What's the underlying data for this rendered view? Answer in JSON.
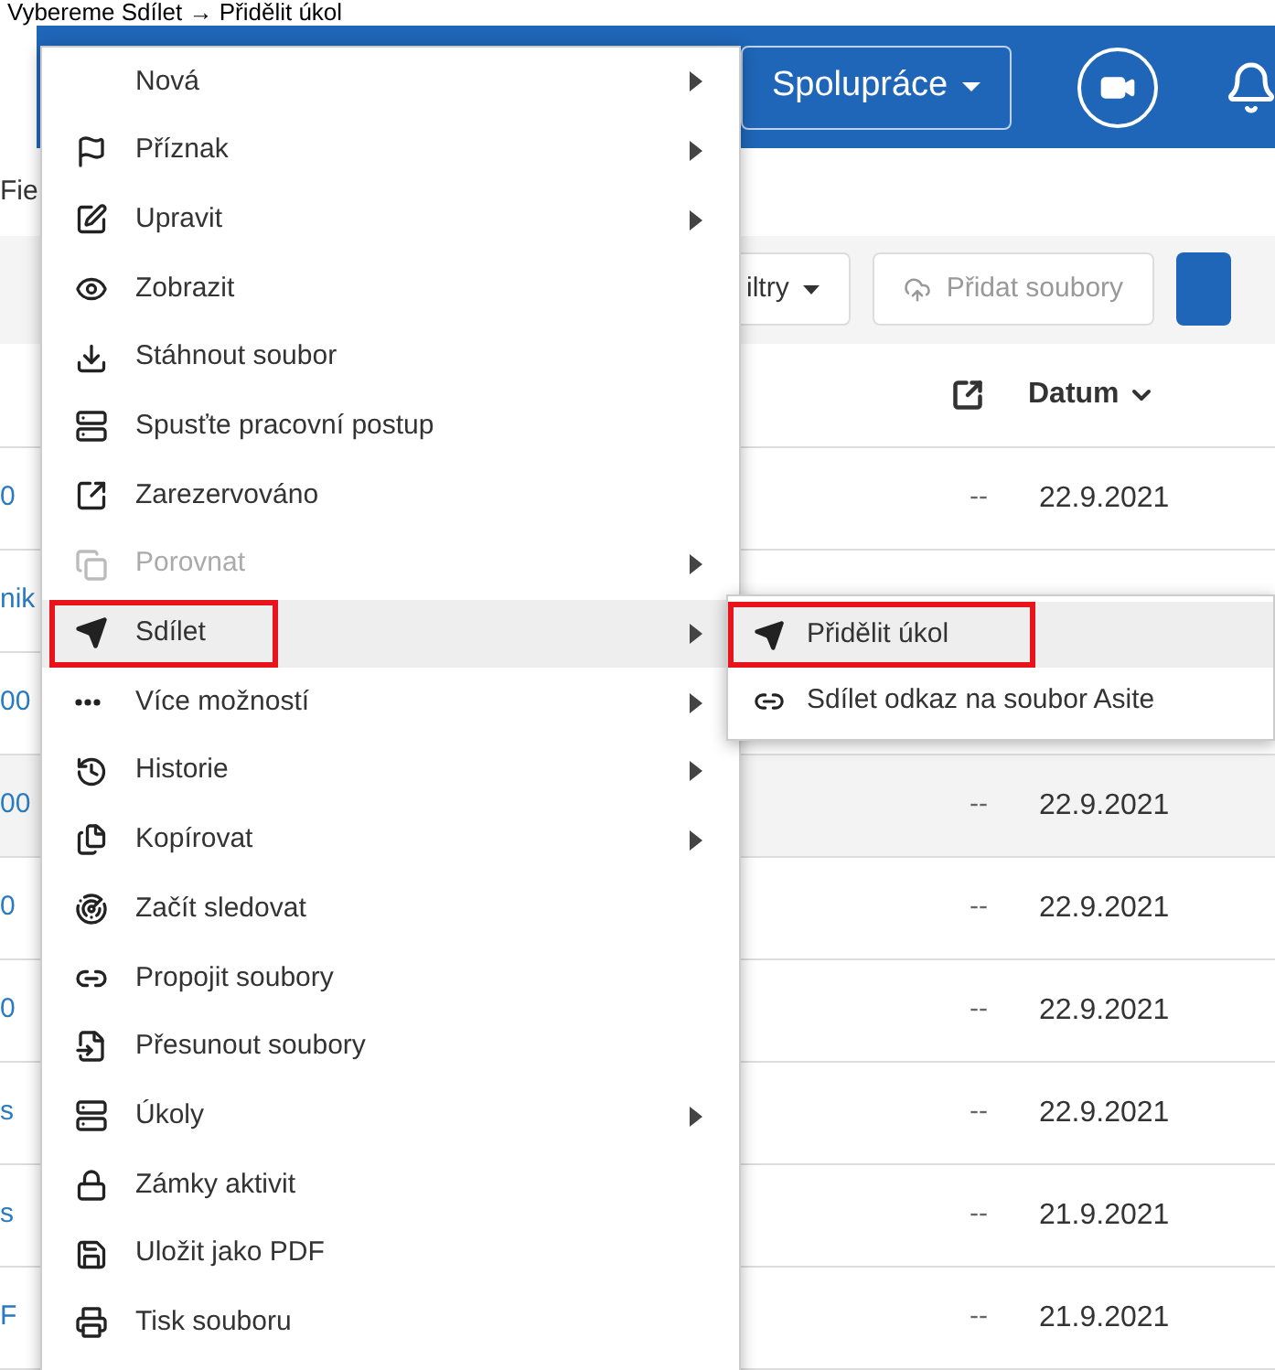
{
  "caption": "Vybereme Sdílet → Přidělit úkol",
  "header": {
    "collab_button": "Spolupráce"
  },
  "breadcrumb": "Fie",
  "toolbar": {
    "filter_button": "iltry",
    "add_files_button": "Přidat soubory"
  },
  "table": {
    "date_column": "Datum",
    "rows": [
      {
        "name": "0",
        "dash": "--",
        "date": "22.9.2021",
        "selected": false
      },
      {
        "name": "nik",
        "selected": false
      },
      {
        "name": "00",
        "selected": false
      },
      {
        "name": "00",
        "dash": "--",
        "date": "22.9.2021",
        "selected": true
      },
      {
        "name": "0",
        "dash": "--",
        "date": "22.9.2021",
        "selected": false
      },
      {
        "name": "0",
        "dash": "--",
        "date": "22.9.2021",
        "selected": false
      },
      {
        "name": "s",
        "dash": "--",
        "date": "22.9.2021",
        "selected": false
      },
      {
        "name": "s",
        "dash": "--",
        "date": "21.9.2021",
        "selected": false
      },
      {
        "name": "F",
        "dash": "--",
        "date": "21.9.2021",
        "selected": false
      }
    ]
  },
  "menu": {
    "items": [
      {
        "label": "Nová",
        "submenu": true,
        "disabled": false,
        "selected": false,
        "highlighted": false
      },
      {
        "label": "Příznak",
        "submenu": true,
        "disabled": false,
        "selected": false,
        "highlighted": false
      },
      {
        "label": "Upravit",
        "submenu": true,
        "disabled": false,
        "selected": false,
        "highlighted": false
      },
      {
        "label": "Zobrazit",
        "submenu": false,
        "disabled": false,
        "selected": false,
        "highlighted": false
      },
      {
        "label": "Stáhnout soubor",
        "submenu": false,
        "disabled": false,
        "selected": false,
        "highlighted": false
      },
      {
        "label": "Spusťte pracovní postup",
        "submenu": false,
        "disabled": false,
        "selected": false,
        "highlighted": false
      },
      {
        "label": "Zarezervováno",
        "submenu": false,
        "disabled": false,
        "selected": false,
        "highlighted": false
      },
      {
        "label": "Porovnat",
        "submenu": true,
        "disabled": true,
        "selected": false,
        "highlighted": false
      },
      {
        "label": "Sdílet",
        "submenu": true,
        "disabled": false,
        "selected": true,
        "highlighted": true
      },
      {
        "label": "Více možností",
        "submenu": true,
        "disabled": false,
        "selected": false,
        "highlighted": false
      },
      {
        "label": "Historie",
        "submenu": true,
        "disabled": false,
        "selected": false,
        "highlighted": false
      },
      {
        "label": "Kopírovat",
        "submenu": true,
        "disabled": false,
        "selected": false,
        "highlighted": false
      },
      {
        "label": "Začít sledovat",
        "submenu": false,
        "disabled": false,
        "selected": false,
        "highlighted": false
      },
      {
        "label": "Propojit soubory",
        "submenu": false,
        "disabled": false,
        "selected": false,
        "highlighted": false
      },
      {
        "label": "Přesunout soubory",
        "submenu": false,
        "disabled": false,
        "selected": false,
        "highlighted": false
      },
      {
        "label": "Úkoly",
        "submenu": true,
        "disabled": false,
        "selected": false,
        "highlighted": false
      },
      {
        "label": "Zámky aktivit",
        "submenu": false,
        "disabled": false,
        "selected": false,
        "highlighted": false
      },
      {
        "label": "Uložit jako PDF",
        "submenu": false,
        "disabled": false,
        "selected": false,
        "highlighted": false
      },
      {
        "label": "Tisk souboru",
        "submenu": false,
        "disabled": false,
        "selected": false,
        "highlighted": false
      }
    ]
  },
  "submenu": {
    "items": [
      {
        "label": "Přidělit úkol",
        "selected": true,
        "highlighted": true
      },
      {
        "label": "Sdílet odkaz na soubor Asite",
        "selected": false,
        "highlighted": false
      }
    ]
  }
}
